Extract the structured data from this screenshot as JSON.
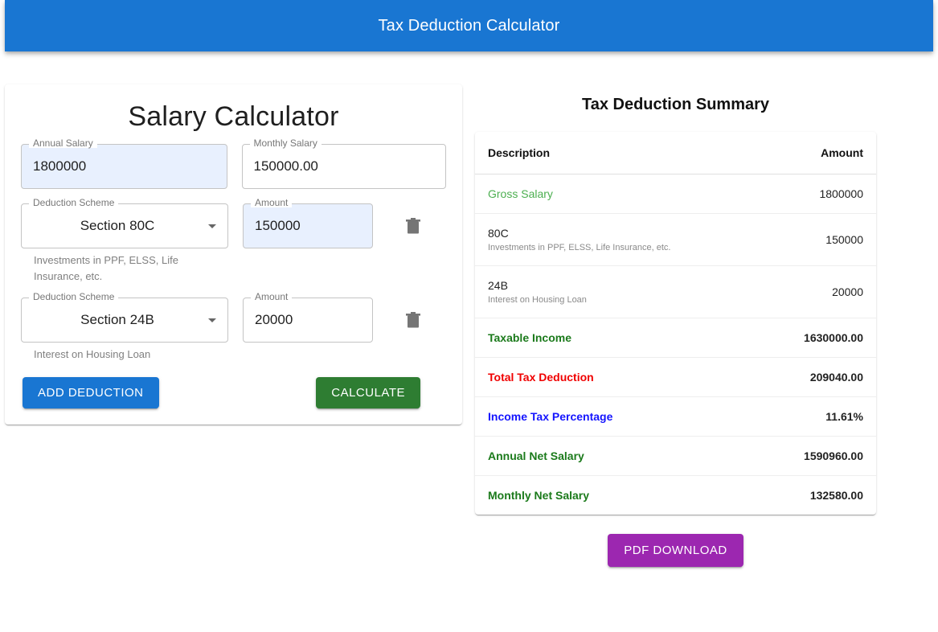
{
  "app": {
    "title": "Tax Deduction Calculator",
    "header_color": "#1976d2"
  },
  "calculator": {
    "title": "Salary Calculator",
    "annual_salary": {
      "label": "Annual Salary",
      "value": "1800000",
      "placeholder": "Annual Salary"
    },
    "monthly_salary": {
      "label": "Monthly Salary",
      "value": "150000.00",
      "placeholder": "Monthly Salary"
    },
    "deductions": [
      {
        "scheme_label": "Deduction Scheme",
        "scheme_value": "Section 80C",
        "amount_label": "Amount",
        "amount_value": "150000",
        "helper": "Investments in PPF, ELSS, Life Insurance, etc.",
        "delete_icon": "trash-icon"
      },
      {
        "scheme_label": "Deduction Scheme",
        "scheme_value": "Section 24B",
        "amount_label": "Amount",
        "amount_value": "20000",
        "helper": "Interest on Housing Loan",
        "delete_icon": "trash-icon"
      }
    ],
    "add_deduction_label": "ADD DEDUCTION",
    "calculate_label": "CALCULATE",
    "add_color": "#1976d2",
    "calculate_color": "#2e7d32"
  },
  "summary": {
    "title": "Tax Deduction Summary",
    "columns": {
      "description": "Description",
      "amount": "Amount"
    },
    "rows": [
      {
        "label": "Gross Salary",
        "sub": "",
        "amount": "1800000",
        "style": "green-light"
      },
      {
        "label": "80C",
        "sub": "Investments in PPF, ELSS, Life Insurance, etc.",
        "amount": "150000",
        "style": "plain"
      },
      {
        "label": "24B",
        "sub": "Interest on Housing Loan",
        "amount": "20000",
        "style": "plain"
      },
      {
        "label": "Taxable Income",
        "sub": "",
        "amount": "1630000.00",
        "style": "green-dark"
      },
      {
        "label": "Total Tax Deduction",
        "sub": "",
        "amount": "209040.00",
        "style": "red"
      },
      {
        "label": "Income Tax Percentage",
        "sub": "",
        "amount": "11.61%",
        "style": "blue"
      },
      {
        "label": "Annual Net Salary",
        "sub": "",
        "amount": "1590960.00",
        "style": "green-dark"
      },
      {
        "label": "Monthly Net Salary",
        "sub": "",
        "amount": "132580.00",
        "style": "green-dark"
      }
    ],
    "pdf_label": "PDF DOWNLOAD",
    "pdf_color": "#9c27b0"
  }
}
